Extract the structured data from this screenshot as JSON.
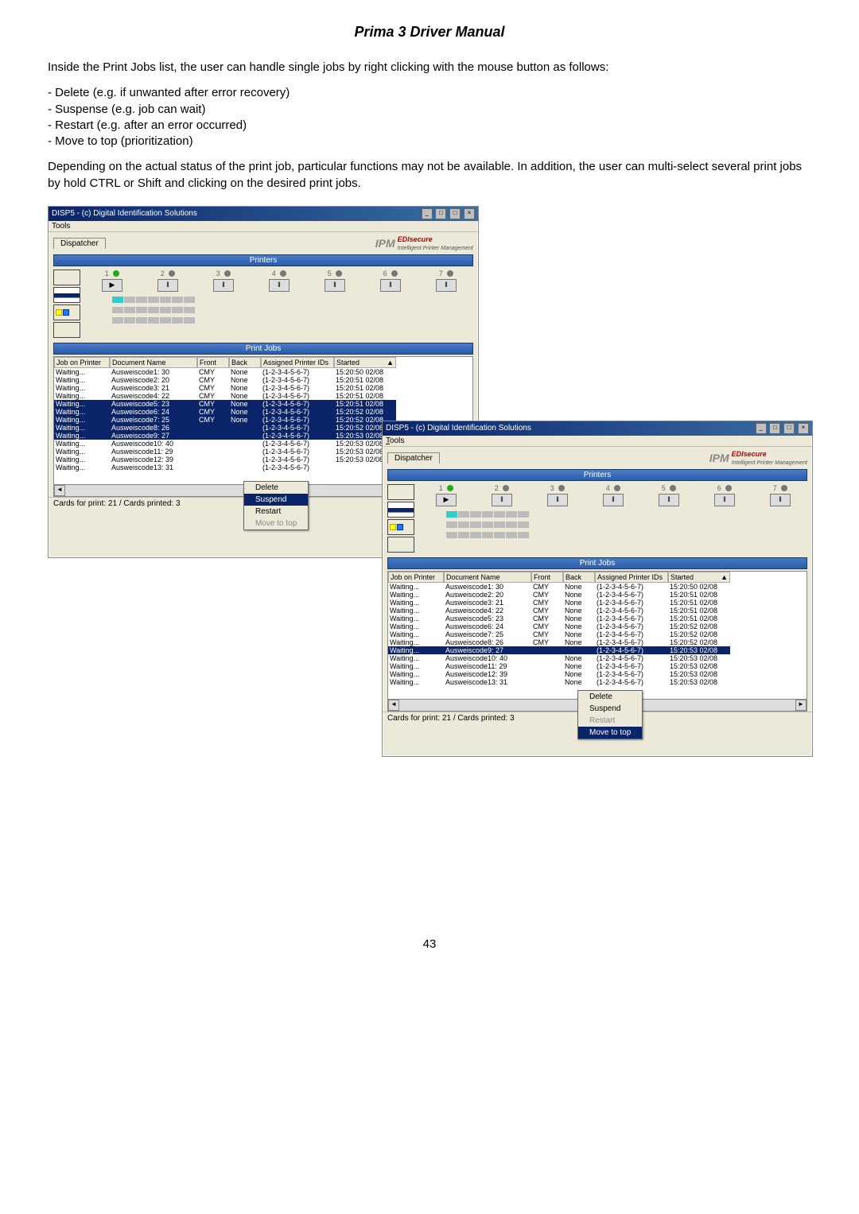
{
  "page_title": "Prima 3 Driver Manual",
  "intro": "Inside the Print Jobs list, the user can handle single jobs by right clicking with the mouse button as follows:",
  "bullets": [
    "- Delete (e.g. if unwanted after error recovery)",
    "- Suspense (e.g. job can wait)",
    "- Restart (e.g. after an error occurred)",
    "- Move to top (prioritization)"
  ],
  "para2": "Depending on the actual status of the print job, particular functions may not be available. In addition, the user can multi-select several print jobs by hold CTRL or Shift and clicking on the desired print jobs.",
  "window_title": "DISP5 - (c) Digital Identification Solutions",
  "menu_tools": "Tools",
  "tab_dispatcher": "Dispatcher",
  "ipm_label": "IPM",
  "edis_label": "EDIsecure",
  "ipm_sub": "Intelligent Printer Management",
  "hdr_printers": "Printers",
  "hdr_printjobs": "Print Jobs",
  "printer_nums": [
    "1",
    "2",
    "3",
    "4",
    "5",
    "6",
    "7"
  ],
  "play_glyph": "▶",
  "pause_glyph": "ǁ",
  "table_headers": {
    "job": "Job on Printer",
    "doc": "Document Name",
    "front": "Front",
    "back": "Back",
    "assigned": "Assigned Printer IDs",
    "started": "Started"
  },
  "rows_a": [
    {
      "job": "Waiting...",
      "doc": "Ausweiscode1: 30",
      "front": "CMY",
      "back": "None",
      "ap": "(1-2-3-4-5-6-7)",
      "st": "15:20:50 02/08",
      "sel": false
    },
    {
      "job": "Waiting...",
      "doc": "Ausweiscode2: 20",
      "front": "CMY",
      "back": "None",
      "ap": "(1-2-3-4-5-6-7)",
      "st": "15:20:51 02/08",
      "sel": false
    },
    {
      "job": "Waiting...",
      "doc": "Ausweiscode3: 21",
      "front": "CMY",
      "back": "None",
      "ap": "(1-2-3-4-5-6-7)",
      "st": "15:20:51 02/08",
      "sel": false
    },
    {
      "job": "Waiting...",
      "doc": "Ausweiscode4: 22",
      "front": "CMY",
      "back": "None",
      "ap": "(1-2-3-4-5-6-7)",
      "st": "15:20:51 02/08",
      "sel": false
    },
    {
      "job": "Waiting...",
      "doc": "Ausweiscode5: 23",
      "front": "CMY",
      "back": "None",
      "ap": "(1-2-3-4-5-6-7)",
      "st": "15:20:51 02/08",
      "sel": true
    },
    {
      "job": "Waiting...",
      "doc": "Ausweiscode6: 24",
      "front": "CMY",
      "back": "None",
      "ap": "(1-2-3-4-5-6-7)",
      "st": "15:20:52 02/08",
      "sel": true
    },
    {
      "job": "Waiting...",
      "doc": "Ausweiscode7: 25",
      "front": "CMY",
      "back": "None",
      "ap": "(1-2-3-4-5-6-7)",
      "st": "15:20:52 02/08",
      "sel": true
    },
    {
      "job": "Waiting...",
      "doc": "Ausweiscode8: 26",
      "front": "",
      "back": "",
      "ap": "(1-2-3-4-5-6-7)",
      "st": "15:20:52 02/08",
      "sel": true
    },
    {
      "job": "Waiting...",
      "doc": "Ausweiscode9: 27",
      "front": "",
      "back": "",
      "ap": "(1-2-3-4-5-6-7)",
      "st": "15:20:53 02/08",
      "sel": true
    },
    {
      "job": "Waiting...",
      "doc": "Ausweiscode10: 40",
      "front": "",
      "back": "",
      "ap": "(1-2-3-4-5-6-7)",
      "st": "15:20:53 02/08",
      "sel": false
    },
    {
      "job": "Waiting...",
      "doc": "Ausweiscode11: 29",
      "front": "",
      "back": "",
      "ap": "(1-2-3-4-5-6-7)",
      "st": "15:20:53 02/08",
      "sel": false
    },
    {
      "job": "Waiting...",
      "doc": "Ausweiscode12: 39",
      "front": "",
      "back": "",
      "ap": "(1-2-3-4-5-6-7)",
      "st": "15:20:53 02/08",
      "sel": false
    },
    {
      "job": "Waiting...",
      "doc": "Ausweiscode13: 31",
      "front": "",
      "back": "",
      "ap": "(1-2-3-4-5-6-7)",
      "st": "",
      "sel": false
    }
  ],
  "rows_b": [
    {
      "job": "Waiting...",
      "doc": "Ausweiscode1: 30",
      "front": "CMY",
      "back": "None",
      "ap": "(1-2-3-4-5-6-7)",
      "st": "15:20:50 02/08",
      "sel": false
    },
    {
      "job": "Waiting...",
      "doc": "Ausweiscode2: 20",
      "front": "CMY",
      "back": "None",
      "ap": "(1-2-3-4-5-6-7)",
      "st": "15:20:51 02/08",
      "sel": false
    },
    {
      "job": "Waiting...",
      "doc": "Ausweiscode3: 21",
      "front": "CMY",
      "back": "None",
      "ap": "(1-2-3-4-5-6-7)",
      "st": "15:20:51 02/08",
      "sel": false
    },
    {
      "job": "Waiting...",
      "doc": "Ausweiscode4: 22",
      "front": "CMY",
      "back": "None",
      "ap": "(1-2-3-4-5-6-7)",
      "st": "15:20:51 02/08",
      "sel": false
    },
    {
      "job": "Waiting...",
      "doc": "Ausweiscode5: 23",
      "front": "CMY",
      "back": "None",
      "ap": "(1-2-3-4-5-6-7)",
      "st": "15:20:51 02/08",
      "sel": false
    },
    {
      "job": "Waiting...",
      "doc": "Ausweiscode6: 24",
      "front": "CMY",
      "back": "None",
      "ap": "(1-2-3-4-5-6-7)",
      "st": "15:20:52 02/08",
      "sel": false
    },
    {
      "job": "Waiting...",
      "doc": "Ausweiscode7: 25",
      "front": "CMY",
      "back": "None",
      "ap": "(1-2-3-4-5-6-7)",
      "st": "15:20:52 02/08",
      "sel": false
    },
    {
      "job": "Waiting...",
      "doc": "Ausweiscode8: 26",
      "front": "CMY",
      "back": "None",
      "ap": "(1-2-3-4-5-6-7)",
      "st": "15:20:52 02/08",
      "sel": false
    },
    {
      "job": "Waiting...",
      "doc": "Ausweiscode9: 27",
      "front": "",
      "back": "",
      "ap": "(1-2-3-4-5-6-7)",
      "st": "15:20:53 02/08",
      "sel": true
    },
    {
      "job": "Waiting...",
      "doc": "Ausweiscode10: 40",
      "front": "",
      "back": "None",
      "ap": "(1-2-3-4-5-6-7)",
      "st": "15:20:53 02/08",
      "sel": false
    },
    {
      "job": "Waiting...",
      "doc": "Ausweiscode11: 29",
      "front": "",
      "back": "None",
      "ap": "(1-2-3-4-5-6-7)",
      "st": "15:20:53 02/08",
      "sel": false
    },
    {
      "job": "Waiting...",
      "doc": "Ausweiscode12: 39",
      "front": "",
      "back": "None",
      "ap": "(1-2-3-4-5-6-7)",
      "st": "15:20:53 02/08",
      "sel": false
    },
    {
      "job": "Waiting...",
      "doc": "Ausweiscode13: 31",
      "front": "",
      "back": "None",
      "ap": "(1-2-3-4-5-6-7)",
      "st": "15:20:53 02/08",
      "sel": false
    }
  ],
  "ctx_a": {
    "delete": "Delete",
    "suspend": "Suspend",
    "restart": "Restart",
    "move": "Move to top"
  },
  "ctx_b": {
    "delete": "Delete",
    "suspend": "Suspend",
    "restart": "Restart",
    "move": "Move to top"
  },
  "status_line": "Cards for print: 21 / Cards printed: 3",
  "page_number": "43"
}
